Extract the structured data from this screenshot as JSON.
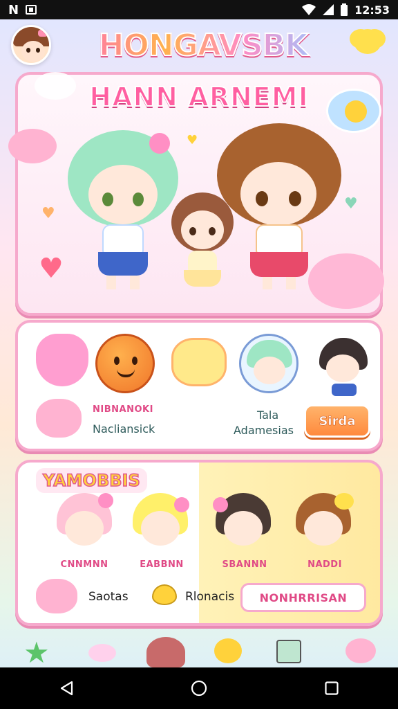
{
  "status_bar": {
    "left_icons": [
      "notification-icon",
      "app-icon"
    ],
    "time": "12:53",
    "right_icons": [
      "wifi-icon",
      "signal-icon",
      "battery-icon"
    ]
  },
  "header": {
    "app_title": "HONGAVSBK"
  },
  "hero": {
    "title": "HANN ARNEMI",
    "characters": [
      "green-haired-girl",
      "small-brown-haired-girl",
      "brown-haired-girl"
    ]
  },
  "panel2": {
    "item_label_small": "NIBNANOKI",
    "item_label": "Nacliansick",
    "right_label_line1": "Tala",
    "right_label_line2": "Adamesias",
    "button_label": "Sirda"
  },
  "panel3": {
    "title": "YAMOBBIS",
    "characters": [
      {
        "name": "CNNMNN"
      },
      {
        "name": "EABBNN"
      },
      {
        "name": "SBANNN"
      },
      {
        "name": "NADDI"
      }
    ],
    "left_text": "Saotas",
    "middle_text": "Rlonacis",
    "input_value": "NONHRRISAN"
  },
  "colors": {
    "accent_pink": "#f6a9cc",
    "title_pink": "#ff5fa1",
    "button_orange": "#ff8a3d",
    "panel_yellow": "#fff2b8"
  },
  "nav": {
    "icons": [
      "back-icon",
      "home-icon",
      "recents-icon"
    ]
  }
}
